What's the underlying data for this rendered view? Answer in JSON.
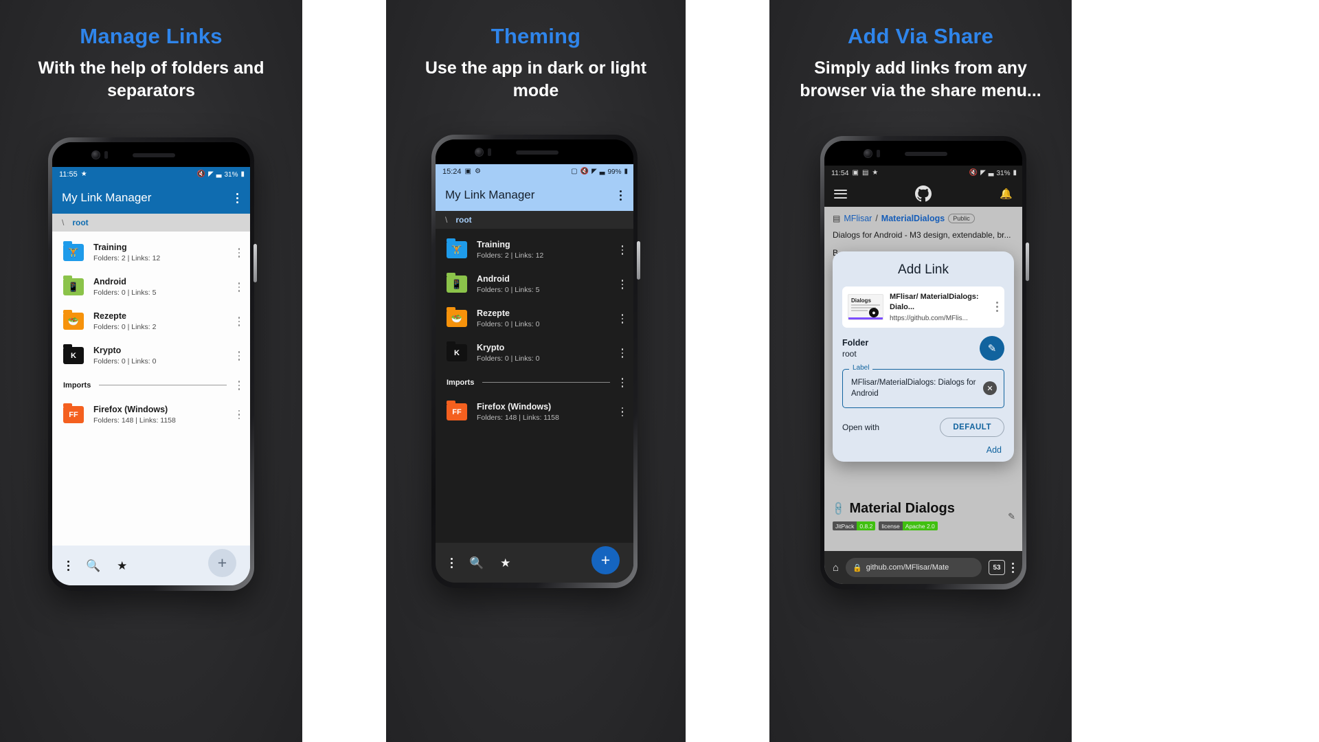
{
  "panels": [
    {
      "caption_title": "Manage Links",
      "caption_sub": "With the help of folders and separators",
      "theme": "light"
    },
    {
      "caption_title": "Theming",
      "caption_sub": "Use the app in dark or light mode",
      "theme": "dark"
    },
    {
      "caption_title": "Add Via Share",
      "caption_sub": "Simply add links from any browser via the share menu...",
      "theme": "github"
    }
  ],
  "phone1": {
    "status": {
      "time": "11:55",
      "star": "★",
      "mute_icon": "🔇",
      "wifi_icon": "◤",
      "signal_icon": "▃",
      "battery": "31%",
      "battery_icon": "▮"
    },
    "appbar": {
      "title": "My Link Manager",
      "overflow_icon": "more-vert"
    },
    "breadcrumb": {
      "slash": "\\",
      "label": "root"
    },
    "rows": [
      {
        "title": "Training",
        "sub": "Folders: 2 | Links: 12",
        "color": "#1e9bea",
        "glyph": "🏋",
        "letter": ""
      },
      {
        "title": "Android",
        "sub": "Folders: 0 | Links: 5",
        "color": "#8bc34a",
        "glyph": "📱",
        "letter": ""
      },
      {
        "title": "Rezepte",
        "sub": "Folders: 0 | Links: 2",
        "color": "#f6920b",
        "glyph": "🥗",
        "letter": ""
      },
      {
        "title": "Krypto",
        "sub": "Folders: 0 | Links: 0",
        "color": "#111111",
        "glyph": "",
        "letter": "K"
      }
    ],
    "separator": {
      "label": "Imports"
    },
    "import_rows": [
      {
        "title": "Firefox (Windows)",
        "sub": "Folders: 148 | Links: 1158",
        "color": "#f4601f",
        "glyph": "",
        "letter": "FF"
      }
    ],
    "bottombar": {
      "overflow_icon": "more-vert",
      "search_icon": "🔍",
      "star_icon": "★",
      "fab_icon": "+"
    }
  },
  "phone2": {
    "status": {
      "time": "15:24",
      "image_icon": "▣",
      "gear_icon": "⚙",
      "cast_icon": "▢",
      "mute_icon": "🔇",
      "wifi_icon": "◤",
      "signal_icon": "▃",
      "battery": "99%",
      "battery_icon": "▮"
    },
    "appbar": {
      "title": "My Link Manager",
      "overflow_icon": "more-vert"
    },
    "breadcrumb": {
      "slash": "\\",
      "label": "root"
    },
    "rows": [
      {
        "title": "Training",
        "sub": "Folders: 2 | Links: 12",
        "color": "#1e9bea",
        "glyph": "🏋",
        "letter": ""
      },
      {
        "title": "Android",
        "sub": "Folders: 0 | Links: 5",
        "color": "#8bc34a",
        "glyph": "📱",
        "letter": ""
      },
      {
        "title": "Rezepte",
        "sub": "Folders: 0 | Links: 0",
        "color": "#f6920b",
        "glyph": "🥗",
        "letter": ""
      },
      {
        "title": "Krypto",
        "sub": "Folders: 0 | Links: 0",
        "color": "#111111",
        "glyph": "",
        "letter": "K"
      }
    ],
    "separator": {
      "label": "Imports"
    },
    "import_rows": [
      {
        "title": "Firefox (Windows)",
        "sub": "Folders: 148 | Links: 1158",
        "color": "#f4601f",
        "glyph": "",
        "letter": "FF"
      }
    ],
    "bottombar": {
      "overflow_icon": "more-vert",
      "search_icon": "🔍",
      "star_icon": "★",
      "fab_icon": "+"
    }
  },
  "phone3": {
    "status": {
      "time": "11:54",
      "icon1": "▣",
      "icon2": "▤",
      "star": "★",
      "mute_icon": "🔇",
      "wifi_icon": "◤",
      "signal_icon": "▃",
      "battery": "31%",
      "battery_icon": "▮"
    },
    "topbar": {
      "menu_icon": "hamburger",
      "logo_icon": "github-mark",
      "bell_icon": "🔔"
    },
    "repo": {
      "book_icon": "▤",
      "owner": "MFlisar",
      "slash": "/",
      "name": "MaterialDialogs",
      "visibility": "Public",
      "description": "Dialogs for Android - M3 design, extendable, br...",
      "description2": "B..."
    },
    "readme": {
      "heading": "Material Dialogs",
      "link_icon": "🔗",
      "badges": [
        {
          "key": "JitPack",
          "value": "0.8.2"
        },
        {
          "key": "license",
          "value": "Apache 2.0"
        }
      ]
    },
    "dialog": {
      "title": "Add Link",
      "preview": {
        "thumb_label": "Dialogs",
        "title": "MFlisar/ MaterialDialogs: Dialo...",
        "url": "https://github.com/MFlis...",
        "overflow_icon": "more-vert"
      },
      "folder_label": "Folder",
      "folder_value": "root",
      "edit_icon": "✎",
      "field_legend": "Label",
      "field_value": "MFlisar/MaterialDialogs: Dialogs for Android",
      "clear_icon": "✕",
      "open_with_label": "Open with",
      "open_with_button": "DEFAULT",
      "add_button": "Add"
    },
    "browserbar": {
      "home_icon": "⌂",
      "lock_icon": "🔒",
      "url": "github.com/MFlisar/Mate",
      "tab_count": "53",
      "overflow_icon": "more-vert"
    }
  }
}
